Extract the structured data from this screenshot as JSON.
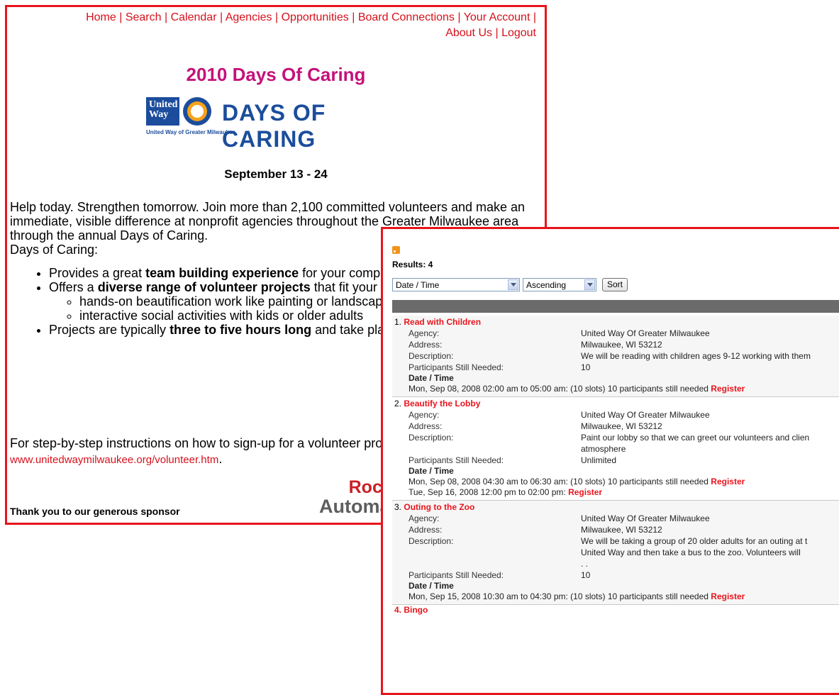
{
  "nav": {
    "items": [
      "Home",
      "Search",
      "Calendar",
      "Agencies",
      "Opportunities",
      "Board Connections",
      "Your Account",
      "About Us",
      "Logout"
    ]
  },
  "event": {
    "title": "2010 Days Of Caring",
    "logo_badge": "United Way",
    "logo_word": "DAYS OF CARING",
    "logo_sub": "United Way of Greater Milwaukee",
    "dates": "September 13 - 24"
  },
  "intro": {
    "paragraph": "Help today. Strengthen tomorrow. Join more than 2,100 committed volunteers and make an immediate, visible difference at nonprofit agencies throughout the Greater Milwaukee area through the annual Days of Caring.",
    "lead": "Days of Caring:"
  },
  "bullets": [
    {
      "pre": "Provides a great ",
      "bold": "team building experience",
      "post": " for your company"
    },
    {
      "pre": "Offers a ",
      "bold": "diverse range of volunteer projects",
      "post": " that fit your schedule and interests:"
    },
    {
      "pre": "Projects are typically ",
      "bold": "three to five hours long",
      "post": " and take place over two weeks"
    }
  ],
  "sub_bullets": [
    "hands-on beautification work like painting or landscaping",
    "interactive social activities with kids or older adults"
  ],
  "instructions": {
    "text": "For step-by-step instructions on how to sign-up for a volunteer project, visit",
    "link": "www.unitedwaymilwaukee.org/volunteer.htm",
    "suffix": "."
  },
  "sponsor": {
    "thanks": "Thank you to our generous sponsor",
    "line1": "Rockwell",
    "line2": "Automation"
  },
  "results": {
    "count_label": "Results: 4",
    "sort_field": "Date / Time",
    "sort_order": "Ascending",
    "sort_button": "Sort",
    "labels": {
      "agency": "Agency:",
      "address": "Address:",
      "description": "Description:",
      "needed": "Participants Still Needed:",
      "datetime": "Date / Time",
      "register": "Register"
    },
    "items": [
      {
        "num": "1.",
        "title": "Read with Children",
        "agency": "United Way Of Greater Milwaukee",
        "address": "Milwaukee, WI 53212",
        "description": "We will be reading with children ages 9-12 working with them",
        "needed": "10",
        "slots": [
          "Mon, Sep 08, 2008 02:00 am to 05:00 am: (10 slots) 10 participants still needed"
        ]
      },
      {
        "num": "2.",
        "title": "Beautify the Lobby",
        "agency": "United Way Of Greater Milwaukee",
        "address": "Milwaukee, WI 53212",
        "description": "Paint our lobby so that we can greet our volunteers and clien",
        "description2": "atmosphere",
        "needed": "Unlimited",
        "slots": [
          "Mon, Sep 08, 2008 04:30 am to 06:30 am: (10 slots) 10 participants still needed",
          "Tue, Sep 16, 2008 12:00 pm to 02:00 pm:"
        ]
      },
      {
        "num": "3.",
        "title": "Outing to the Zoo",
        "agency": "United Way Of Greater Milwaukee",
        "address": "Milwaukee, WI 53212",
        "description": "We will be taking a group of 20 older adults for an outing at t",
        "description2": "United Way and then take a bus to the zoo. Volunteers will",
        "description3": ". .",
        "needed": "10",
        "slots": [
          "Mon, Sep 15, 2008 10:30 am to 04:30 pm: (10 slots) 10 participants still needed"
        ]
      }
    ],
    "next_partial": "4. Bingo"
  }
}
